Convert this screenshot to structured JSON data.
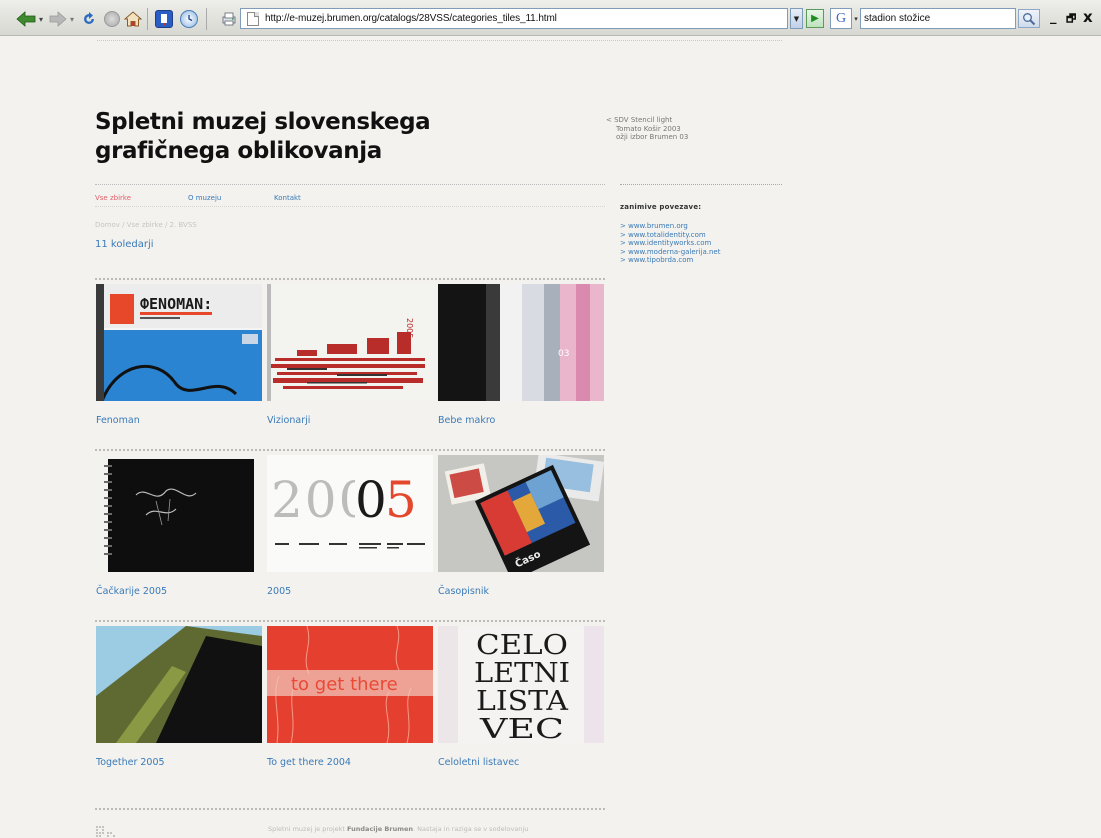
{
  "browser": {
    "url": "http://e-muzej.brumen.org/catalogs/28VSS/categories_tiles_11.html",
    "search_engine_glyph": "G",
    "search_value": "stadion stožice",
    "icons": [
      "back-icon",
      "forward-icon",
      "reload-icon",
      "stop-icon",
      "home-icon",
      "bookmarks-icon",
      "history-icon",
      "print-icon",
      "go-icon",
      "search-icon",
      "minimize-icon",
      "maximize-icon",
      "close-icon"
    ],
    "window_buttons": {
      "minimize": "_",
      "maximize": "🗗",
      "close": "x"
    }
  },
  "site": {
    "title_line1": "Spletni muzej slovenskega",
    "title_line2": "grafičnega oblikovanja"
  },
  "credit": {
    "line1": "< SDV Stencil light",
    "line2": "Tomato Košir 2003",
    "line3": "ožji izbor Brumen 03"
  },
  "links": {
    "title": "zanimive povezave:",
    "items": [
      "> www.brumen.org",
      "> www.totalidentity.com",
      "> www.identityworks.com",
      "> www.moderna-galerija.net",
      "> www.tipobrda.com"
    ]
  },
  "nav": {
    "items": [
      "Vse zbirke",
      "O muzeju",
      "Kontakt"
    ]
  },
  "breadcrumb": "Domov / Vse zbirke / 2. BVSS",
  "count_label": "11 koledarji",
  "tiles": [
    {
      "caption": "Fenoman",
      "cover_text": "ФENOMAN:"
    },
    {
      "caption": "Vizionarji",
      "cover_text": "2005"
    },
    {
      "caption": "Bebe makro",
      "cover_text": "03"
    },
    {
      "caption": "Čačkarije 2005",
      "cover_text": ""
    },
    {
      "caption": "2005",
      "cover_text": "2005"
    },
    {
      "caption": "Časopisnik",
      "cover_text": "Časo"
    },
    {
      "caption": "Together 2005",
      "cover_text": ""
    },
    {
      "caption": "To get there 2004",
      "cover_text": "to get there"
    },
    {
      "caption": "Celoletni listavec",
      "cover_text": "CELO LETNI LISTA VEC"
    }
  ],
  "footer": {
    "text_pre": "Spletni muzej je projekt ",
    "text_bold": "Fundacije Brumen",
    "text_post": ". Nastaja in raziga se v sodelovanju"
  }
}
